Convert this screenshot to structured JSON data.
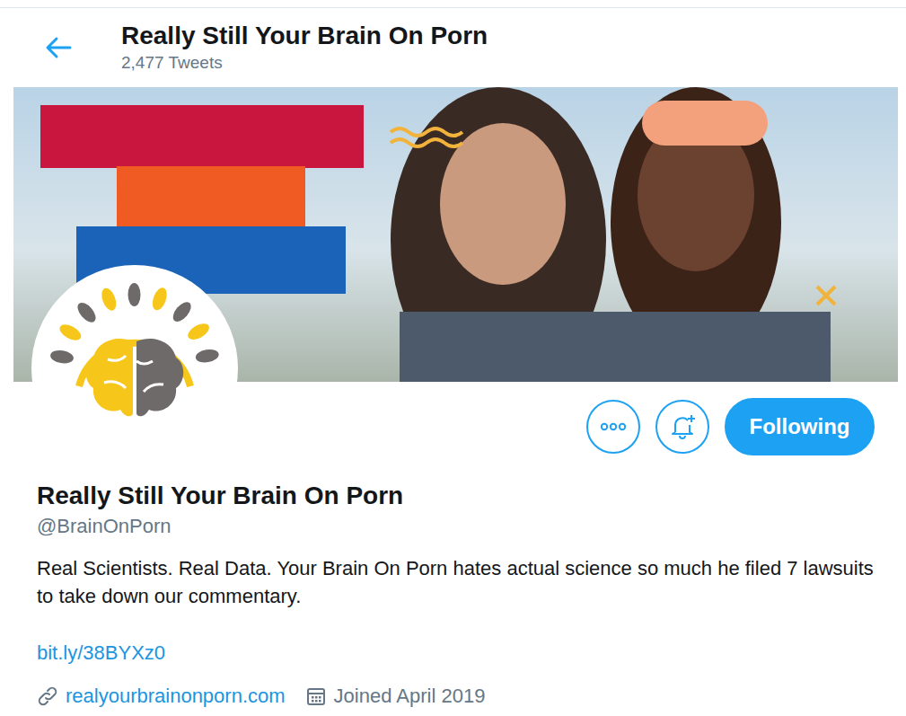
{
  "header": {
    "title": "Really Still Your Brain On Porn",
    "tweet_count": "2,477 Tweets"
  },
  "follow_button": {
    "label": "Following",
    "following": true
  },
  "profile": {
    "name": "Really Still Your Brain On Porn",
    "handle": "@BrainOnPorn",
    "bio": "Real Scientists. Real Data. Your Brain On Porn hates actual science so much he filed 7 lawsuits to take down our commentary.",
    "link": "bit.ly/38BYXz0",
    "website": "realyourbrainonporn.com",
    "joined": "Joined April 2019"
  }
}
